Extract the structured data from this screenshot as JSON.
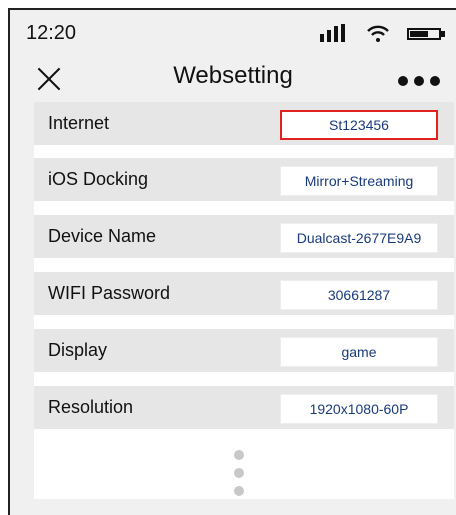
{
  "status": {
    "time": "12:20"
  },
  "header": {
    "title": "Websetting"
  },
  "settings": [
    {
      "label": "Internet",
      "value": "St123456"
    },
    {
      "label": "iOS Docking",
      "value": "Mirror+Streaming"
    },
    {
      "label": "Device Name",
      "value": "Dualcast-2677E9A9"
    },
    {
      "label": "WIFI Password",
      "value": "30661287"
    },
    {
      "label": "Display",
      "value": "game"
    },
    {
      "label": "Resolution",
      "value": "1920x1080-60P"
    }
  ],
  "colors": {
    "value_text": "#1a3a7a",
    "active_border": "#e12020",
    "row_bg": "#e6e6e6"
  },
  "icons": [
    "signal-icon",
    "wifi-icon",
    "battery-icon",
    "close-icon",
    "more-icon",
    "more-vertical-icon"
  ]
}
